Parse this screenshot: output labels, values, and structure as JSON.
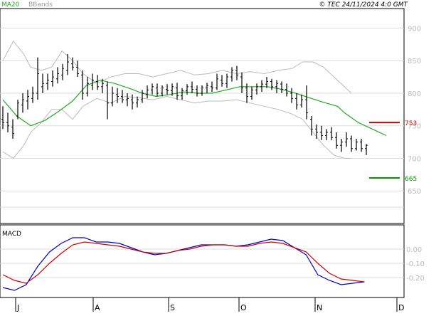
{
  "header": {
    "legend_ma": "MA20",
    "legend_bb": "BBands",
    "copyright": "© TEC 24/11/2024 4:0 GMT"
  },
  "colors": {
    "ma": "#22aa22",
    "bbands": "#bbbbbb",
    "price": "#000000",
    "grid": "#dddddd",
    "resistance": "#cc0000",
    "support": "#009900",
    "macd": "#0000cc",
    "signal": "#cc0000"
  },
  "chart_data": [
    {
      "type": "ohlc",
      "title": "",
      "ylim": [
        600,
        930
      ],
      "y_ticks": [
        650,
        700,
        750,
        800,
        850,
        900
      ],
      "x_months": [
        "J",
        "A",
        "S",
        "O",
        "N",
        "D"
      ],
      "grid": true,
      "levels": [
        {
          "label": "753",
          "value": 755,
          "color": "#cc0000"
        },
        {
          "label": "665",
          "value": 670,
          "color": "#009900"
        }
      ],
      "bars": [
        {
          "d": 0,
          "o": 760,
          "h": 780,
          "l": 745,
          "c": 755
        },
        {
          "d": 1,
          "o": 755,
          "h": 770,
          "l": 740,
          "c": 750
        },
        {
          "d": 2,
          "o": 748,
          "h": 760,
          "l": 730,
          "c": 738
        },
        {
          "d": 3,
          "o": 765,
          "h": 790,
          "l": 760,
          "c": 785
        },
        {
          "d": 4,
          "o": 782,
          "h": 800,
          "l": 770,
          "c": 790
        },
        {
          "d": 5,
          "o": 788,
          "h": 805,
          "l": 775,
          "c": 795
        },
        {
          "d": 6,
          "o": 792,
          "h": 810,
          "l": 785,
          "c": 800
        },
        {
          "d": 7,
          "o": 800,
          "h": 855,
          "l": 790,
          "c": 830
        },
        {
          "d": 8,
          "o": 810,
          "h": 830,
          "l": 800,
          "c": 815
        },
        {
          "d": 9,
          "o": 815,
          "h": 830,
          "l": 805,
          "c": 820
        },
        {
          "d": 10,
          "o": 818,
          "h": 835,
          "l": 810,
          "c": 825
        },
        {
          "d": 11,
          "o": 822,
          "h": 840,
          "l": 815,
          "c": 830
        },
        {
          "d": 12,
          "o": 828,
          "h": 845,
          "l": 820,
          "c": 838
        },
        {
          "d": 13,
          "o": 835,
          "h": 860,
          "l": 828,
          "c": 848
        },
        {
          "d": 14,
          "o": 845,
          "h": 855,
          "l": 835,
          "c": 840
        },
        {
          "d": 15,
          "o": 840,
          "h": 850,
          "l": 825,
          "c": 830
        },
        {
          "d": 16,
          "o": 828,
          "h": 835,
          "l": 790,
          "c": 800
        },
        {
          "d": 17,
          "o": 800,
          "h": 825,
          "l": 795,
          "c": 815
        },
        {
          "d": 18,
          "o": 812,
          "h": 830,
          "l": 805,
          "c": 820
        },
        {
          "d": 19,
          "o": 818,
          "h": 828,
          "l": 805,
          "c": 810
        },
        {
          "d": 20,
          "o": 810,
          "h": 822,
          "l": 800,
          "c": 815
        },
        {
          "d": 21,
          "o": 812,
          "h": 818,
          "l": 760,
          "c": 785
        },
        {
          "d": 22,
          "o": 785,
          "h": 810,
          "l": 780,
          "c": 800
        },
        {
          "d": 23,
          "o": 798,
          "h": 808,
          "l": 785,
          "c": 795
        },
        {
          "d": 24,
          "o": 795,
          "h": 805,
          "l": 785,
          "c": 790
        },
        {
          "d": 25,
          "o": 790,
          "h": 800,
          "l": 780,
          "c": 792
        },
        {
          "d": 26,
          "o": 790,
          "h": 798,
          "l": 775,
          "c": 785
        },
        {
          "d": 27,
          "o": 785,
          "h": 795,
          "l": 778,
          "c": 790
        },
        {
          "d": 28,
          "o": 790,
          "h": 805,
          "l": 785,
          "c": 800
        },
        {
          "d": 29,
          "o": 798,
          "h": 812,
          "l": 792,
          "c": 805
        },
        {
          "d": 30,
          "o": 805,
          "h": 815,
          "l": 798,
          "c": 810
        },
        {
          "d": 31,
          "o": 808,
          "h": 815,
          "l": 795,
          "c": 800
        },
        {
          "d": 32,
          "o": 800,
          "h": 812,
          "l": 795,
          "c": 808
        },
        {
          "d": 33,
          "o": 806,
          "h": 814,
          "l": 798,
          "c": 804
        },
        {
          "d": 34,
          "o": 804,
          "h": 815,
          "l": 796,
          "c": 810
        },
        {
          "d": 35,
          "o": 808,
          "h": 816,
          "l": 790,
          "c": 796
        },
        {
          "d": 36,
          "o": 796,
          "h": 808,
          "l": 790,
          "c": 804
        },
        {
          "d": 37,
          "o": 804,
          "h": 814,
          "l": 798,
          "c": 810
        },
        {
          "d": 38,
          "o": 810,
          "h": 818,
          "l": 800,
          "c": 806
        },
        {
          "d": 39,
          "o": 806,
          "h": 812,
          "l": 795,
          "c": 800
        },
        {
          "d": 40,
          "o": 800,
          "h": 812,
          "l": 796,
          "c": 808
        },
        {
          "d": 41,
          "o": 808,
          "h": 816,
          "l": 800,
          "c": 812
        },
        {
          "d": 42,
          "o": 810,
          "h": 818,
          "l": 802,
          "c": 808
        },
        {
          "d": 43,
          "o": 808,
          "h": 830,
          "l": 805,
          "c": 822
        },
        {
          "d": 44,
          "o": 820,
          "h": 828,
          "l": 810,
          "c": 815
        },
        {
          "d": 45,
          "o": 815,
          "h": 830,
          "l": 808,
          "c": 825
        },
        {
          "d": 46,
          "o": 825,
          "h": 840,
          "l": 818,
          "c": 835
        },
        {
          "d": 47,
          "o": 835,
          "h": 842,
          "l": 820,
          "c": 828
        },
        {
          "d": 48,
          "o": 825,
          "h": 832,
          "l": 800,
          "c": 808
        },
        {
          "d": 49,
          "o": 808,
          "h": 815,
          "l": 785,
          "c": 795
        },
        {
          "d": 50,
          "o": 795,
          "h": 810,
          "l": 790,
          "c": 805
        },
        {
          "d": 51,
          "o": 805,
          "h": 815,
          "l": 798,
          "c": 810
        },
        {
          "d": 52,
          "o": 810,
          "h": 820,
          "l": 802,
          "c": 814
        },
        {
          "d": 53,
          "o": 814,
          "h": 825,
          "l": 808,
          "c": 818
        },
        {
          "d": 54,
          "o": 818,
          "h": 822,
          "l": 805,
          "c": 810
        },
        {
          "d": 55,
          "o": 810,
          "h": 820,
          "l": 800,
          "c": 815
        },
        {
          "d": 56,
          "o": 814,
          "h": 818,
          "l": 800,
          "c": 806
        },
        {
          "d": 57,
          "o": 806,
          "h": 815,
          "l": 795,
          "c": 800
        },
        {
          "d": 58,
          "o": 800,
          "h": 808,
          "l": 785,
          "c": 792
        },
        {
          "d": 59,
          "o": 792,
          "h": 800,
          "l": 775,
          "c": 782
        },
        {
          "d": 60,
          "o": 782,
          "h": 798,
          "l": 778,
          "c": 790
        },
        {
          "d": 61,
          "o": 790,
          "h": 812,
          "l": 760,
          "c": 770
        },
        {
          "d": 62,
          "o": 760,
          "h": 765,
          "l": 735,
          "c": 745
        },
        {
          "d": 63,
          "o": 745,
          "h": 752,
          "l": 730,
          "c": 740
        },
        {
          "d": 64,
          "o": 740,
          "h": 750,
          "l": 728,
          "c": 735
        },
        {
          "d": 65,
          "o": 735,
          "h": 745,
          "l": 728,
          "c": 740
        },
        {
          "d": 66,
          "o": 740,
          "h": 748,
          "l": 728,
          "c": 732
        },
        {
          "d": 67,
          "o": 732,
          "h": 740,
          "l": 715,
          "c": 720
        },
        {
          "d": 68,
          "o": 720,
          "h": 730,
          "l": 710,
          "c": 725
        },
        {
          "d": 69,
          "o": 725,
          "h": 740,
          "l": 718,
          "c": 730
        },
        {
          "d": 70,
          "o": 730,
          "h": 735,
          "l": 710,
          "c": 715
        },
        {
          "d": 71,
          "o": 715,
          "h": 730,
          "l": 712,
          "c": 725
        },
        {
          "d": 72,
          "o": 725,
          "h": 730,
          "l": 710,
          "c": 715
        },
        {
          "d": 73,
          "o": 715,
          "h": 722,
          "l": 705,
          "c": 720
        }
      ],
      "ma20": [
        [
          0,
          790
        ],
        [
          4,
          765
        ],
        [
          8,
          750
        ],
        [
          12,
          758
        ],
        [
          16,
          772
        ],
        [
          20,
          788
        ],
        [
          24,
          812
        ],
        [
          28,
          820
        ],
        [
          32,
          815
        ],
        [
          36,
          808
        ],
        [
          40,
          800
        ],
        [
          44,
          795
        ],
        [
          48,
          798
        ],
        [
          52,
          802
        ],
        [
          56,
          800
        ],
        [
          60,
          800
        ],
        [
          64,
          805
        ],
        [
          68,
          810
        ],
        [
          72,
          810
        ],
        [
          76,
          810
        ],
        [
          80,
          806
        ],
        [
          84,
          800
        ],
        [
          88,
          793
        ],
        [
          92,
          786
        ],
        [
          96,
          780
        ],
        [
          98,
          770
        ],
        [
          102,
          755
        ],
        [
          106,
          745
        ],
        [
          110,
          735
        ]
      ],
      "bb_upper": [
        [
          0,
          850
        ],
        [
          3,
          880
        ],
        [
          6,
          860
        ],
        [
          8,
          840
        ],
        [
          11,
          835
        ],
        [
          14,
          840
        ],
        [
          17,
          865
        ],
        [
          20,
          850
        ],
        [
          23,
          830
        ],
        [
          27,
          815
        ],
        [
          31,
          825
        ],
        [
          35,
          830
        ],
        [
          39,
          830
        ],
        [
          43,
          825
        ],
        [
          47,
          830
        ],
        [
          51,
          835
        ],
        [
          55,
          828
        ],
        [
          59,
          830
        ],
        [
          63,
          835
        ],
        [
          67,
          830
        ],
        [
          71,
          833
        ],
        [
          75,
          830
        ],
        [
          79,
          835
        ],
        [
          83,
          838
        ],
        [
          86,
          848
        ],
        [
          89,
          848
        ],
        [
          92,
          840
        ],
        [
          95,
          825
        ],
        [
          98,
          810
        ],
        [
          100,
          800
        ]
      ],
      "bb_lower": [
        [
          0,
          710
        ],
        [
          3,
          700
        ],
        [
          6,
          720
        ],
        [
          8,
          740
        ],
        [
          11,
          755
        ],
        [
          14,
          775
        ],
        [
          17,
          775
        ],
        [
          20,
          760
        ],
        [
          23,
          780
        ],
        [
          27,
          792
        ],
        [
          31,
          785
        ],
        [
          35,
          795
        ],
        [
          39,
          793
        ],
        [
          43,
          790
        ],
        [
          47,
          795
        ],
        [
          51,
          790
        ],
        [
          55,
          785
        ],
        [
          59,
          788
        ],
        [
          63,
          788
        ],
        [
          67,
          790
        ],
        [
          71,
          785
        ],
        [
          75,
          780
        ],
        [
          79,
          775
        ],
        [
          83,
          768
        ],
        [
          86,
          760
        ],
        [
          89,
          740
        ],
        [
          92,
          720
        ],
        [
          95,
          705
        ],
        [
          98,
          700
        ],
        [
          100,
          700
        ]
      ]
    },
    {
      "type": "line",
      "title": "MACD",
      "ylim": [
        -0.34,
        0.17
      ],
      "y_ticks": [
        {
          "label": "0.00",
          "value": 0.0
        },
        {
          "label": "-0.10",
          "value": -0.1
        },
        {
          "label": "-0.20",
          "value": -0.2
        }
      ],
      "grid": true,
      "series": [
        {
          "name": "",
          "color": "#0000cc",
          "values": [
            [
              0,
              -0.27
            ],
            [
              4,
              -0.29
            ],
            [
              8,
              -0.25
            ],
            [
              12,
              -0.12
            ],
            [
              16,
              -0.02
            ],
            [
              20,
              0.04
            ],
            [
              24,
              0.08
            ],
            [
              28,
              0.08
            ],
            [
              32,
              0.05
            ],
            [
              36,
              0.05
            ],
            [
              40,
              0.04
            ],
            [
              44,
              0.01
            ],
            [
              48,
              -0.02
            ],
            [
              52,
              -0.04
            ],
            [
              56,
              -0.03
            ],
            [
              60,
              -0.01
            ],
            [
              64,
              0.01
            ],
            [
              68,
              0.03
            ],
            [
              72,
              0.03
            ],
            [
              76,
              0.03
            ],
            [
              80,
              0.02
            ],
            [
              84,
              0.03
            ],
            [
              88,
              0.05
            ],
            [
              92,
              0.07
            ],
            [
              96,
              0.06
            ],
            [
              100,
              0.01
            ],
            [
              104,
              -0.04
            ],
            [
              108,
              -0.18
            ],
            [
              112,
              -0.22
            ],
            [
              116,
              -0.25
            ],
            [
              120,
              -0.24
            ],
            [
              124,
              -0.23
            ]
          ]
        },
        {
          "name": "",
          "color": "#cc0000",
          "values": [
            [
              0,
              -0.18
            ],
            [
              4,
              -0.22
            ],
            [
              8,
              -0.24
            ],
            [
              12,
              -0.18
            ],
            [
              16,
              -0.1
            ],
            [
              20,
              -0.03
            ],
            [
              24,
              0.03
            ],
            [
              28,
              0.05
            ],
            [
              32,
              0.04
            ],
            [
              36,
              0.03
            ],
            [
              40,
              0.02
            ],
            [
              44,
              0.0
            ],
            [
              48,
              -0.02
            ],
            [
              52,
              -0.03
            ],
            [
              56,
              -0.03
            ],
            [
              60,
              -0.01
            ],
            [
              64,
              0.0
            ],
            [
              68,
              0.02
            ],
            [
              72,
              0.03
            ],
            [
              76,
              0.03
            ],
            [
              80,
              0.02
            ],
            [
              84,
              0.02
            ],
            [
              88,
              0.04
            ],
            [
              92,
              0.05
            ],
            [
              96,
              0.04
            ],
            [
              100,
              0.01
            ],
            [
              104,
              -0.02
            ],
            [
              108,
              -0.1
            ],
            [
              112,
              -0.17
            ],
            [
              116,
              -0.21
            ],
            [
              120,
              -0.22
            ],
            [
              124,
              -0.23
            ]
          ]
        }
      ]
    }
  ]
}
